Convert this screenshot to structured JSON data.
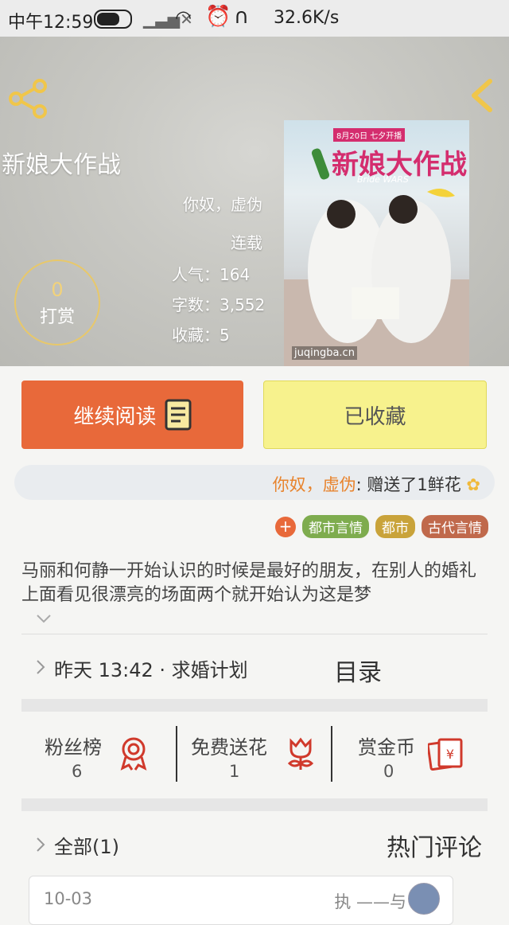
{
  "status_bar": {
    "time": "中午12:59",
    "speed": "32.6K/s"
  },
  "book": {
    "title": "新娘大作战",
    "author": "你奴，虚伪",
    "status": "连载",
    "popularity": "人气：164",
    "words": "字数：3,552",
    "favorites": "收藏：5",
    "tip_count": "0",
    "tip_label": "打赏",
    "cover": {
      "title": "新娘大作战",
      "date": "8月20日 七夕开播",
      "subtitle": "Bride WARS",
      "site": "juqingba.cn"
    }
  },
  "actions": {
    "read_label": "继续阅读",
    "fav_label": "已收藏"
  },
  "gift": {
    "user": "你奴，虚伪",
    "text": ": 赠送了1鲜花"
  },
  "tags": [
    {
      "label": "都市言情",
      "color": "#7eac4e"
    },
    {
      "label": "都市",
      "color": "#c9a33a"
    },
    {
      "label": "古代言情",
      "color": "#c0694b"
    }
  ],
  "description": "马丽和何静一开始认识的时候是最好的朋友，在别人的婚礼上面看见很漂亮的场面两个就开始认为这是梦",
  "chapter": {
    "latest": "昨天 13:42 · 求婚计划",
    "toc_label": "目录"
  },
  "stats": [
    {
      "label": "粉丝榜",
      "value": "6",
      "icon": "medal-icon"
    },
    {
      "label": "免费送花",
      "value": "1",
      "icon": "flower-icon"
    },
    {
      "label": "赏金币",
      "value": "0",
      "icon": "red-envelope-icon"
    }
  ],
  "comments": {
    "all_label": "全部(1)",
    "hot_label": "热门评论",
    "first": {
      "date": "10-03",
      "user": "执 ——与"
    }
  },
  "colors": {
    "accent_orange": "#e8693a",
    "fav_yellow": "#f7f28d",
    "icon_red": "#d0392b"
  }
}
